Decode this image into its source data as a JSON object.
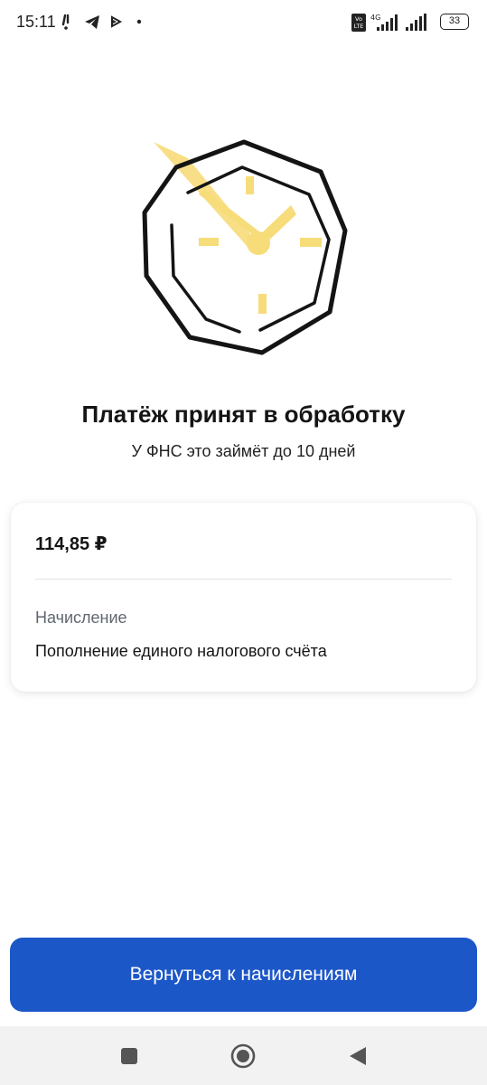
{
  "status_bar": {
    "time": "15:11",
    "left_icons": [
      "notification-icon",
      "telegram-icon",
      "play-icon",
      "dot-icon"
    ],
    "right_icons": [
      "volte-icon",
      "signal-4g-icon",
      "signal-icon"
    ],
    "network_label": "4G",
    "volte_label": "Vo LTE",
    "battery_level": "33"
  },
  "illustration": {
    "icon": "clock-icon",
    "colors": {
      "outline": "#141414",
      "accent": "#f7dc7a"
    }
  },
  "main": {
    "title": "Платёж принят в обработку",
    "subtitle": "У ФНС это займёт до 10 дней"
  },
  "card": {
    "amount": "114,85 ₽",
    "charge_label": "Начисление",
    "charge_value": "Пополнение единого налогового счёта"
  },
  "primary_button": {
    "label": "Вернуться к начислениям",
    "color": "#1c57c8"
  },
  "nav_bar": {
    "icons": [
      "recent-apps-icon",
      "home-icon",
      "back-icon"
    ]
  }
}
